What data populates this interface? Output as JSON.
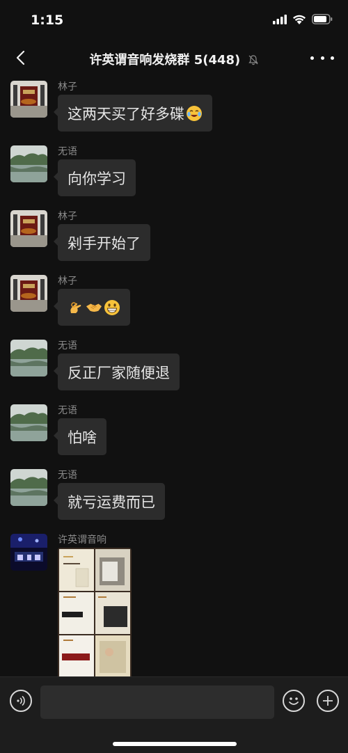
{
  "status_bar": {
    "time": "1:15"
  },
  "header": {
    "title": "许英谓音响发烧群 5(448)"
  },
  "messages": [
    {
      "sender": "林子",
      "text": "这两天买了好多碟",
      "avatar": "room-avatar",
      "emoji": "crying-laughing-emoji"
    },
    {
      "sender": "无语",
      "text": "向你学习",
      "avatar": "lake-avatar"
    },
    {
      "sender": "林子",
      "text": "剁手开始了",
      "avatar": "room-avatar"
    },
    {
      "sender": "林子",
      "text": "",
      "avatar": "room-avatar",
      "emoji": [
        "ok-hand-emoji",
        "handshake-emoji",
        "grinning-emoji"
      ]
    },
    {
      "sender": "无语",
      "text": "反正厂家随便退",
      "avatar": "lake-avatar"
    },
    {
      "sender": "无语",
      "text": "怕啥",
      "avatar": "lake-avatar"
    },
    {
      "sender": "无语",
      "text": "就亏运费而已",
      "avatar": "lake-avatar"
    },
    {
      "sender": "许英谓音响",
      "avatar": "stage-avatar",
      "image": "cd-albums-photo"
    }
  ],
  "colors": {
    "background": "#111111",
    "bubble": "#2c2c2c",
    "input_bar": "#1d1d1d",
    "sender_text": "#8a8a8a"
  }
}
